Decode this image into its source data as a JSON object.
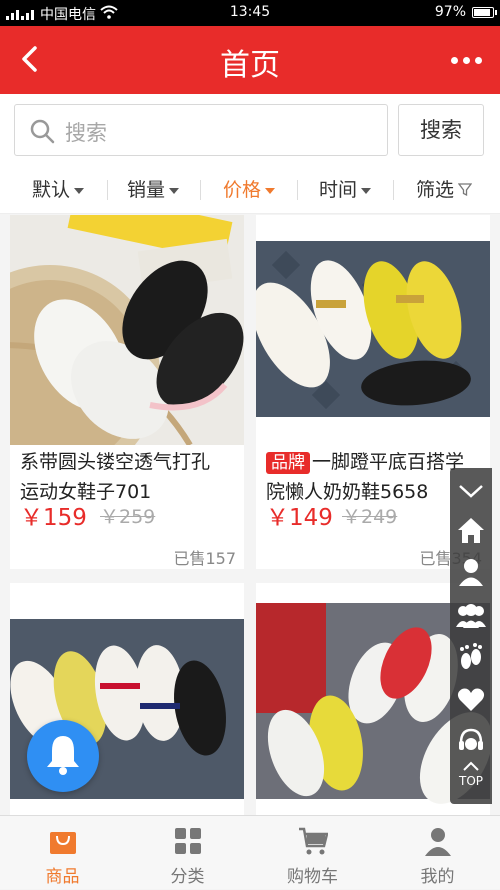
{
  "status_bar": {
    "carrier": "中国电信",
    "time": "13:45",
    "battery": "97%",
    "battery_level": 0.97
  },
  "nav": {
    "title": "首页"
  },
  "search": {
    "placeholder": "搜索",
    "button_label": "搜索"
  },
  "sort": {
    "items": [
      {
        "label": "默认"
      },
      {
        "label": "销量"
      },
      {
        "label": "价格"
      },
      {
        "label": "时间"
      },
      {
        "label": "筛选"
      }
    ],
    "active": "价格"
  },
  "products": [
    {
      "name_line1": "系带圆头镂空透气打孔",
      "name_line2": "运动女鞋子701",
      "brand": "",
      "price": "￥159",
      "old_price": "￥259",
      "sold": "已售157"
    },
    {
      "name_line1": "一脚蹬平底百搭学",
      "name_line2": "院懒人奶奶鞋5658",
      "brand": "品牌",
      "price": "￥149",
      "old_price": "￥249",
      "sold": "已售354"
    },
    {
      "name_line1": "",
      "name_line2": "",
      "brand": "",
      "price": "",
      "old_price": "",
      "sold": ""
    },
    {
      "name_line1": "",
      "name_line2": "",
      "brand": "",
      "price": "",
      "old_price": "",
      "sold": ""
    }
  ],
  "float_bar": {
    "top_label": "TOP"
  },
  "tabbar": {
    "items": [
      {
        "label": "商品"
      },
      {
        "label": "分类"
      },
      {
        "label": "购物车"
      },
      {
        "label": "我的"
      }
    ]
  },
  "colors": {
    "brand_red": "#e82c2a",
    "accent_orange": "#f07a2e",
    "bell_blue": "#2f8ff3"
  }
}
